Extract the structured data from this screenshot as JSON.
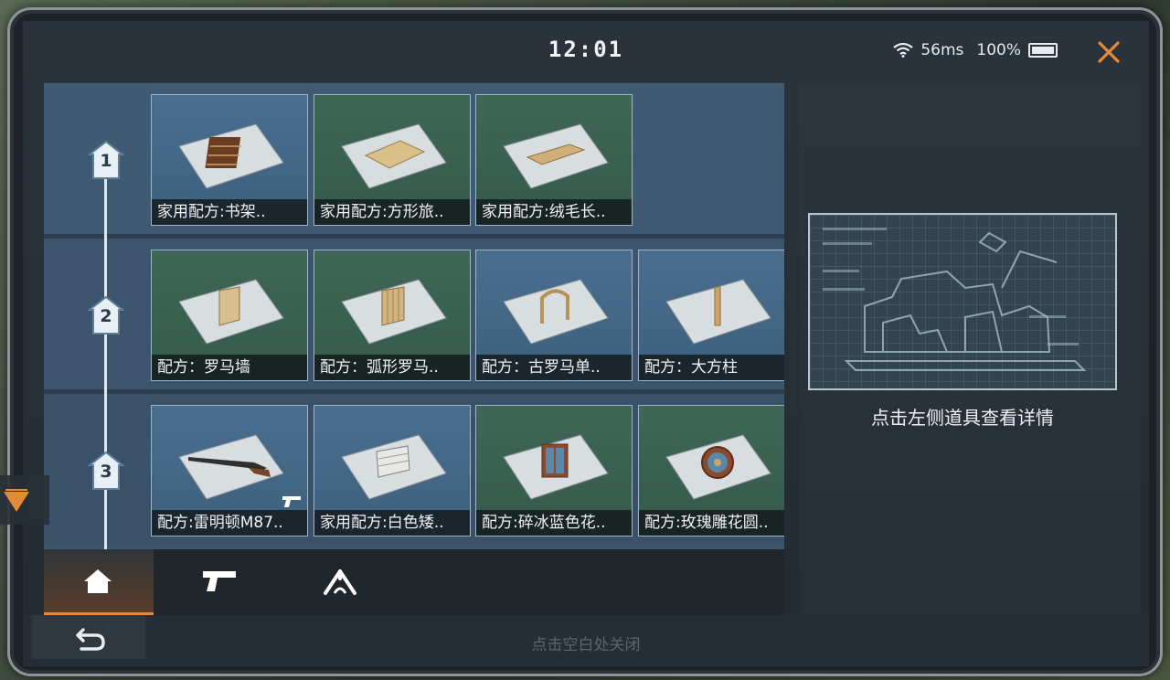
{
  "status": {
    "time": "12:01",
    "ping": "56ms",
    "battery": "100%"
  },
  "levels": [
    "1",
    "2",
    "3"
  ],
  "rows": [
    {
      "level": "1",
      "items": [
        {
          "label": "家用配方:书架..",
          "bg": "blue",
          "icon": "bookshelf-blueprint-icon"
        },
        {
          "label": "家用配方:方形旅..",
          "bg": "green",
          "icon": "square-rug-blueprint-icon"
        },
        {
          "label": "家用配方:绒毛长..",
          "bg": "green",
          "icon": "long-rug-blueprint-icon"
        }
      ]
    },
    {
      "level": "2",
      "items": [
        {
          "label": "配方：罗马墙",
          "bg": "green",
          "icon": "roman-wall-blueprint-icon"
        },
        {
          "label": "配方：弧形罗马..",
          "bg": "green",
          "icon": "curved-roman-wall-blueprint-icon"
        },
        {
          "label": "配方：古罗马单..",
          "bg": "blue",
          "icon": "roman-arch-blueprint-icon"
        },
        {
          "label": "配方：大方柱",
          "bg": "blue",
          "icon": "square-pillar-blueprint-icon"
        }
      ]
    },
    {
      "level": "3",
      "items": [
        {
          "label": "配方:雷明顿M87..",
          "bg": "blue",
          "icon": "shotgun-blueprint-icon"
        },
        {
          "label": "家用配方:白色矮..",
          "bg": "blue",
          "icon": "white-cabinet-blueprint-icon"
        },
        {
          "label": "配方:碎冰蓝色花..",
          "bg": "green",
          "icon": "blue-flower-window-blueprint-icon"
        },
        {
          "label": "配方:玫瑰雕花圆..",
          "bg": "green",
          "icon": "rose-round-window-blueprint-icon"
        }
      ]
    }
  ],
  "tabs": [
    {
      "name": "home",
      "icon": "home-icon",
      "active": true
    },
    {
      "name": "weapon",
      "icon": "pistol-icon",
      "active": false
    },
    {
      "name": "camp",
      "icon": "tent-icon",
      "active": false
    }
  ],
  "detail": {
    "hint": "点击左侧道具查看详情"
  },
  "footer": {
    "close_hint": "点击空白处关闭"
  },
  "colors": {
    "accent": "#e58a37",
    "card_blue": "#4a6f8e",
    "card_green": "#3f6656"
  }
}
